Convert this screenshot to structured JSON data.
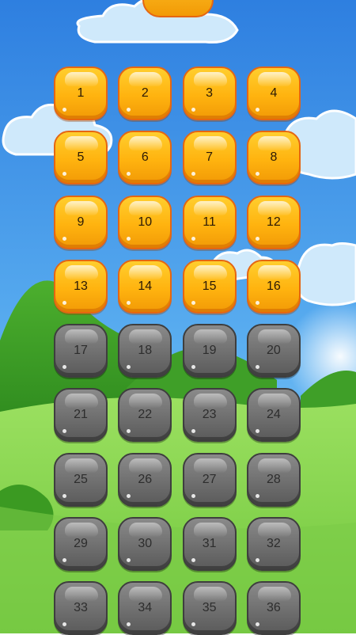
{
  "colors": {
    "sky_top": "#2e7fe0",
    "sky_bottom": "#7fc8f5",
    "grass": "#7ed04a",
    "unlocked_button": "#ffb30f",
    "locked_button": "#6f6f6f"
  },
  "level_select": {
    "levels": [
      {
        "label": "1",
        "locked": false
      },
      {
        "label": "2",
        "locked": false
      },
      {
        "label": "3",
        "locked": false
      },
      {
        "label": "4",
        "locked": false
      },
      {
        "label": "5",
        "locked": false
      },
      {
        "label": "6",
        "locked": false
      },
      {
        "label": "7",
        "locked": false
      },
      {
        "label": "8",
        "locked": false
      },
      {
        "label": "9",
        "locked": false
      },
      {
        "label": "10",
        "locked": false
      },
      {
        "label": "11",
        "locked": false
      },
      {
        "label": "12",
        "locked": false
      },
      {
        "label": "13",
        "locked": false
      },
      {
        "label": "14",
        "locked": false
      },
      {
        "label": "15",
        "locked": false
      },
      {
        "label": "16",
        "locked": false
      },
      {
        "label": "17",
        "locked": true
      },
      {
        "label": "18",
        "locked": true
      },
      {
        "label": "19",
        "locked": true
      },
      {
        "label": "20",
        "locked": true
      },
      {
        "label": "21",
        "locked": true
      },
      {
        "label": "22",
        "locked": true
      },
      {
        "label": "23",
        "locked": true
      },
      {
        "label": "24",
        "locked": true
      },
      {
        "label": "25",
        "locked": true
      },
      {
        "label": "26",
        "locked": true
      },
      {
        "label": "27",
        "locked": true
      },
      {
        "label": "28",
        "locked": true
      },
      {
        "label": "29",
        "locked": true
      },
      {
        "label": "30",
        "locked": true
      },
      {
        "label": "31",
        "locked": true
      },
      {
        "label": "32",
        "locked": true
      },
      {
        "label": "33",
        "locked": true
      },
      {
        "label": "34",
        "locked": true
      },
      {
        "label": "35",
        "locked": true
      },
      {
        "label": "36",
        "locked": true
      }
    ]
  }
}
